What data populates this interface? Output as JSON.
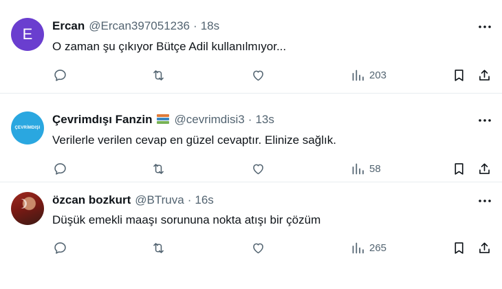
{
  "tweets": [
    {
      "name": "Ercan",
      "handle": "@Ercan397051236",
      "dot": "·",
      "time": "18s",
      "text": "O zaman şu çıkıyor Bütçe Adil kullanılmıyor...",
      "views": "203",
      "avatar_letter": "E"
    },
    {
      "name": "Çevrimdışı Fanzin",
      "handle": "@cevrimdisi3",
      "dot": "·",
      "time": "13s",
      "text": "Verilerle verilen cevap en güzel cevaptır. Elinize sağlık.",
      "views": "58",
      "avatar_text": "ÇEVRİMDIŞI"
    },
    {
      "name": "özcan bozkurt",
      "handle": "@BTruva",
      "dot": "·",
      "time": "16s",
      "text": "Düşük emekli maaşı sorununa nokta atışı bir çözüm",
      "views": "265"
    }
  ],
  "icons": {
    "reply": "reply-icon",
    "retweet": "retweet-icon",
    "like": "heart-icon",
    "views": "views-chart-icon",
    "bookmark": "bookmark-icon",
    "share": "share-icon",
    "more": "more-dots-icon",
    "badge": "books-emoji-icon"
  },
  "colors": {
    "text": "#0f1419",
    "muted": "#536471",
    "divider": "#e8ecef",
    "avatar_e": "#6a3ecf",
    "avatar_fanzin": "#2aa7e0"
  }
}
